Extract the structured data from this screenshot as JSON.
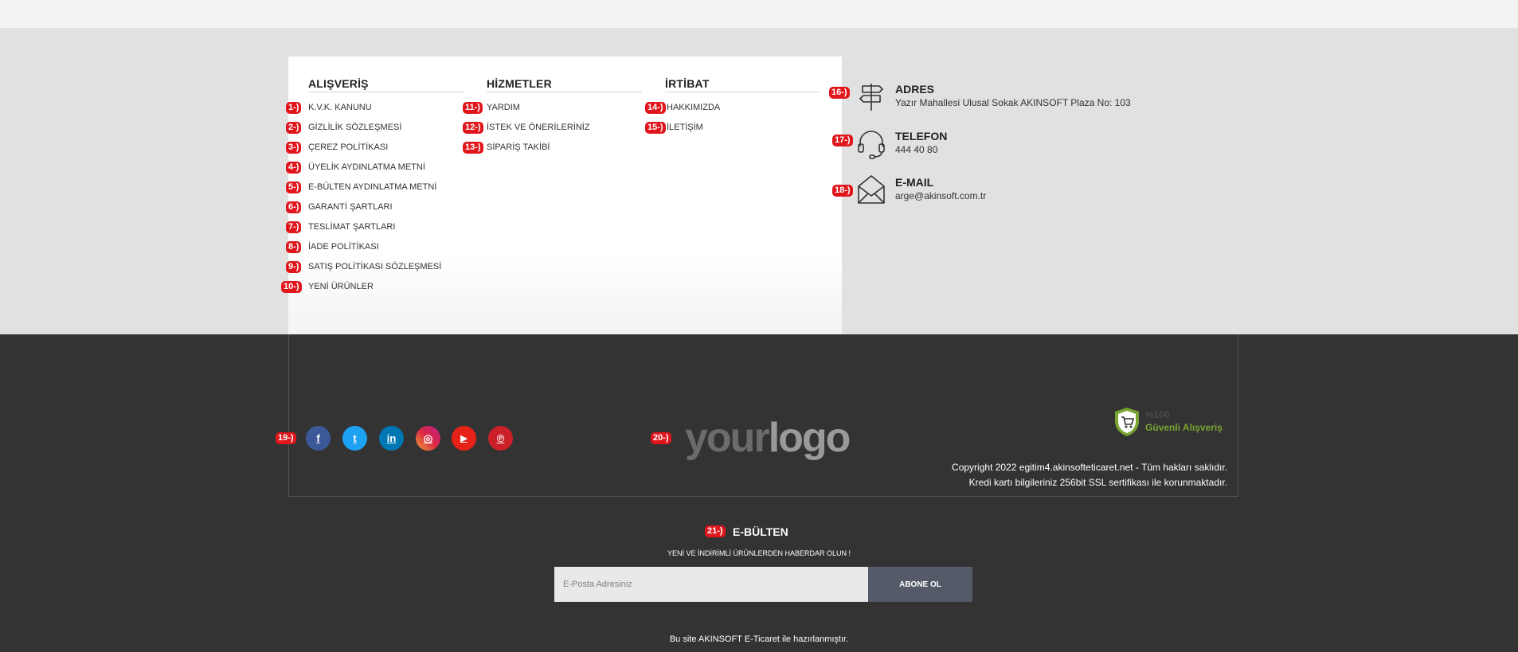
{
  "columns": {
    "alisveris": {
      "title": "ALIŞVERİŞ",
      "items": [
        {
          "badge": "1-)",
          "label": "K.V.K. KANUNU"
        },
        {
          "badge": "2-)",
          "label": "GİZLİLİK SÖZLEŞMESİ"
        },
        {
          "badge": "3-)",
          "label": "ÇEREZ POLİTİKASI"
        },
        {
          "badge": "4-)",
          "label": "ÜYELİK AYDINLATMA METNİ"
        },
        {
          "badge": "5-)",
          "label": "E-BÜLTEN AYDINLATMA METNİ"
        },
        {
          "badge": "6-)",
          "label": "GARANTİ ŞARTLARI"
        },
        {
          "badge": "7-)",
          "label": "TESLİMAT ŞARTLARI"
        },
        {
          "badge": "8-)",
          "label": "İADE POLİTİKASI"
        },
        {
          "badge": "9-)",
          "label": "SATIŞ POLİTİKASI SÖZLEŞMESİ"
        },
        {
          "badge": "10-)",
          "label": "YENİ ÜRÜNLER"
        }
      ]
    },
    "hizmetler": {
      "title": "HİZMETLER",
      "items": [
        {
          "badge": "11-)",
          "label": "YARDIM"
        },
        {
          "badge": "12-)",
          "label": "İSTEK VE ÖNERİLERİNİZ"
        },
        {
          "badge": "13-)",
          "label": "SİPARİŞ TAKİBİ"
        }
      ]
    },
    "irtibat": {
      "title": "İRTİBAT",
      "items": [
        {
          "badge": "14-)",
          "label": "HAKKIMIZDA"
        },
        {
          "badge": "15-)",
          "label": "İLETİŞİM"
        }
      ]
    }
  },
  "contact": {
    "adres": {
      "badge": "16-)",
      "title": "ADRES",
      "value": "Yazır Mahallesi Ulusal Sokak AKINSOFT Plaza No: 103",
      "icon": "signpost-icon"
    },
    "telefon": {
      "badge": "17-)",
      "title": "TELEFON",
      "value": "444 40 80",
      "icon": "headset-icon"
    },
    "email": {
      "badge": "18-)",
      "title": "E-MAIL",
      "value": "arge@akinsoft.com.tr",
      "icon": "envelope-icon"
    }
  },
  "social": {
    "badge": "19-)",
    "items": [
      {
        "name": "facebook",
        "glyph": "f",
        "color": "#3b5998"
      },
      {
        "name": "twitter",
        "glyph": "t",
        "color": "#1da1f2"
      },
      {
        "name": "linkedin",
        "glyph": "in",
        "color": "#0077b5"
      },
      {
        "name": "instagram",
        "glyph": "◎",
        "color": "#d6249f"
      },
      {
        "name": "youtube",
        "glyph": "▶",
        "color": "#e62117"
      },
      {
        "name": "pinterest",
        "glyph": "℗",
        "color": "#cb2027"
      }
    ]
  },
  "logo": {
    "badge": "20-)",
    "part1": "your",
    "part2": "logo"
  },
  "secure": {
    "percent": "%100",
    "text": "Güvenli Alışveriş"
  },
  "copyright": {
    "line1": "Copyright 2022 egitim4.akinsofteticaret.net - Tüm hakları saklıdır.",
    "line2": "Kredi kartı bilgileriniz 256bit SSL sertifikası ile korunmaktadır."
  },
  "ebulten": {
    "badge": "21-)",
    "title": "E-BÜLTEN",
    "subtitle": "YENİ VE İNDİRİMLİ ÜRÜNLERDEN HABERDAR OLUN !",
    "placeholder": "E-Posta Adresiniz",
    "button": "ABONE OL"
  },
  "footer_note": "Bu site AKINSOFT E-Ticaret ile hazırlanmıştır.",
  "colors": {
    "badge": "#e0161c",
    "dark_bg": "#333333",
    "grey_bg": "#e1e1e1",
    "button": "#545a68",
    "secure_green": "#7aa431"
  }
}
